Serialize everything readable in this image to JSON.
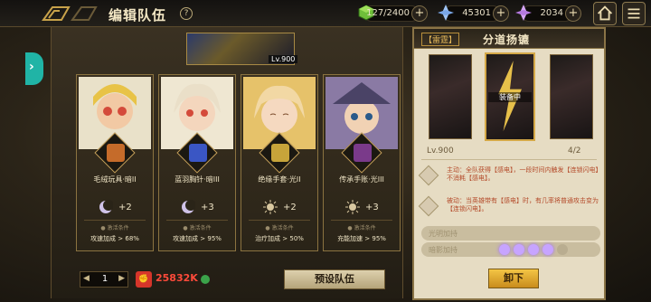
{
  "header": {
    "title": "编辑队伍",
    "help_icon": "?"
  },
  "resources": [
    {
      "name": "energy",
      "value": "127/2400",
      "icon": "green-cube-icon",
      "color": "#6fbf3a"
    },
    {
      "name": "crystal",
      "value": "45301",
      "icon": "blue-crystal-icon",
      "color": "#7aa7e8"
    },
    {
      "name": "premium",
      "value": "2034",
      "icon": "purple-crystal-icon",
      "color": "#b57ae0"
    }
  ],
  "side_tab": {
    "label": "›"
  },
  "banner": {
    "level": "Lv.900"
  },
  "team": [
    {
      "name": "毛绒玩具·暗II",
      "bonus_value": "+2",
      "condition": "● 激活条件",
      "bonus": "攻速加成 > 68%",
      "accent": "#c56b2a",
      "element": "moon"
    },
    {
      "name": "蓝羽胸针·暗III",
      "bonus_value": "+3",
      "condition": "● 激活条件",
      "bonus": "攻速加成 > 95%",
      "accent": "#3a56c4",
      "element": "moon"
    },
    {
      "name": "绝缘手套·光II",
      "bonus_value": "+2",
      "condition": "● 激活条件",
      "bonus": "治疗加成 > 50%",
      "accent": "#c7a43a",
      "element": "sun"
    },
    {
      "name": "传承手账·光III",
      "bonus_value": "+3",
      "condition": "● 激活条件",
      "bonus": "充能加速 > 95%",
      "accent": "#7a3a8a",
      "element": "sun"
    }
  ],
  "bottom": {
    "team_index": "1",
    "prev": "◀",
    "next": "▶",
    "power": "25832K",
    "power_icon": "fist-icon",
    "preset_label": "预设队伍"
  },
  "detail": {
    "tag": "【雷霆】",
    "title": "分道扬镳",
    "equipped": "装备中",
    "level": "Lv.900",
    "stars": "4/2",
    "active_skill": "主动：全队获得【感电】，一段时间内触发【连锁闪电】不消耗【感电】。",
    "passive_skill": "被动：当英雄带有【感电】时，有几率将普通攻击变为【连锁闪电】。",
    "light_bonus_label": "光明加持",
    "dark_bonus_label": "暗影加持",
    "unload_label": "卸下",
    "dark_orbs_active": 4,
    "dark_orbs_total": 5
  },
  "colors": {
    "accent": "#d4a847",
    "danger": "#ff4a3a",
    "teal": "#20b4a6",
    "orb_active": "#c7a4ff"
  }
}
